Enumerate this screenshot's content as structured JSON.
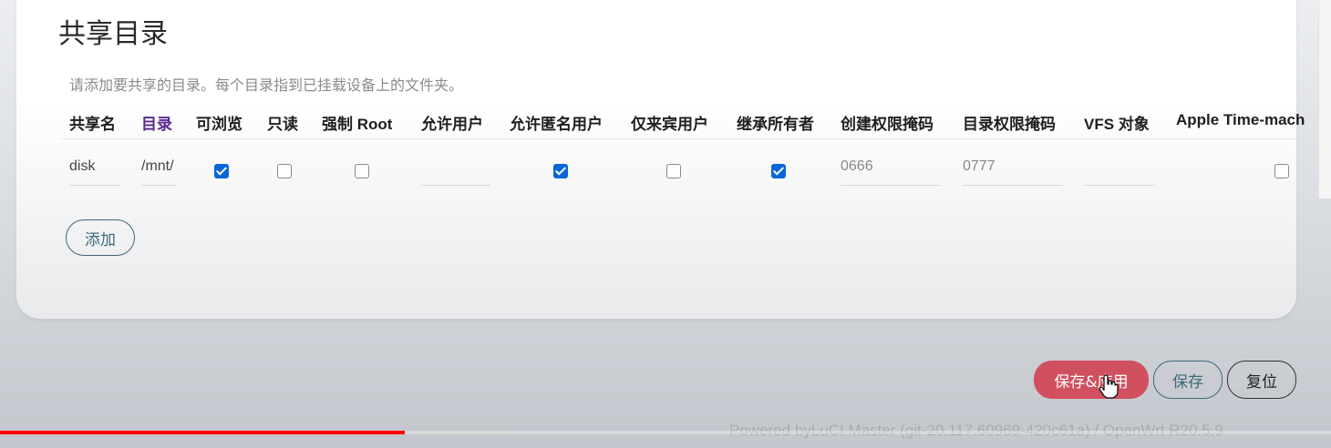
{
  "section": {
    "title": "共享目录",
    "description": "请添加要共享的目录。每个目录指到已挂载设备上的文件夹。"
  },
  "table": {
    "headers": [
      "共享名",
      "目录",
      "可浏览",
      "只读",
      "强制 Root",
      "允许用户",
      "允许匿名用户",
      "仅来宾用户",
      "继承所有者",
      "创建权限掩码",
      "目录权限掩码",
      "VFS 对象",
      "Apple Time-mach"
    ],
    "row": {
      "name": "disk",
      "path": "/mnt/",
      "browseable": true,
      "read_only": false,
      "force_root": false,
      "allowed_users": "",
      "guest_ok": true,
      "guest_only": false,
      "inherit_owner": true,
      "create_mask": "0666",
      "dir_mask": "0777",
      "vfs_objects": "",
      "timemachine": false
    }
  },
  "buttons": {
    "add": "添加",
    "save_apply": "保存&应用",
    "save": "保存",
    "reset": "复位"
  },
  "colors": {
    "accent_blue": "#0a66d8",
    "apply_red": "#d05060",
    "link_purple": "#5b2a8f",
    "progress_red": "#ff0000"
  },
  "footer": "Powered byLuCI Master (git-20.117.60969-420c61a) / OpenWrt R20.5.9",
  "video_progress": 0.304
}
